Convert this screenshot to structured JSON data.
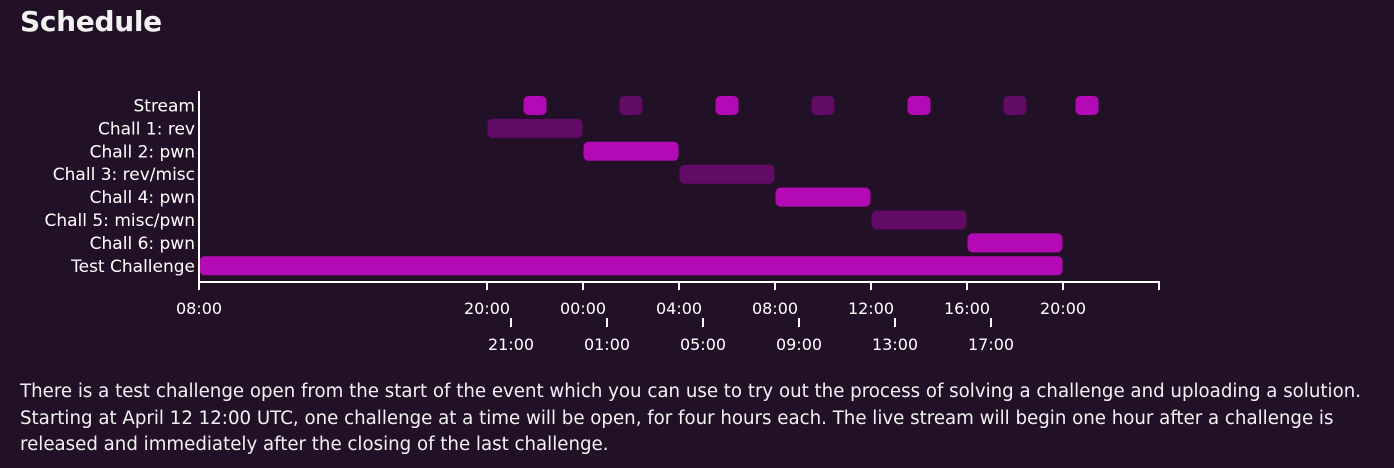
{
  "page": {
    "title": "Schedule",
    "description": "There is a test challenge open from the start of the event which you can use to try out the process of solving a challenge and uploading a solution. Starting at April 12 12:00 UTC, one challenge at a time will be open, for four hours each. The live stream will begin one hour after a challenge is released and immediately after the closing of the last challenge."
  },
  "colors": {
    "background": "#221126",
    "bright": "#b30ab5",
    "dim": "#620b66",
    "text": "#ffffff"
  },
  "chart_data": {
    "type": "gantt",
    "x_unit": "hours from axis start (08:00)",
    "xlim": [
      0,
      40
    ],
    "rows": [
      "Stream",
      "Chall 1: rev",
      "Chall 2: pwn",
      "Chall 3: rev/misc",
      "Chall 4: pwn",
      "Chall 5: misc/pwn",
      "Chall 6: pwn",
      "Test Challenge"
    ],
    "bars": [
      {
        "row": "Stream",
        "start": 13.5,
        "end": 14.5,
        "color": "bright"
      },
      {
        "row": "Stream",
        "start": 17.5,
        "end": 18.5,
        "color": "dim"
      },
      {
        "row": "Stream",
        "start": 21.5,
        "end": 22.5,
        "color": "bright"
      },
      {
        "row": "Stream",
        "start": 25.5,
        "end": 26.5,
        "color": "dim"
      },
      {
        "row": "Stream",
        "start": 29.5,
        "end": 30.5,
        "color": "bright"
      },
      {
        "row": "Stream",
        "start": 33.5,
        "end": 34.5,
        "color": "dim"
      },
      {
        "row": "Stream",
        "start": 36.5,
        "end": 37.5,
        "color": "bright"
      },
      {
        "row": "Chall 1: rev",
        "start": 12,
        "end": 16,
        "color": "dim"
      },
      {
        "row": "Chall 2: pwn",
        "start": 16,
        "end": 20,
        "color": "bright"
      },
      {
        "row": "Chall 3: rev/misc",
        "start": 20,
        "end": 24,
        "color": "dim"
      },
      {
        "row": "Chall 4: pwn",
        "start": 24,
        "end": 28,
        "color": "bright"
      },
      {
        "row": "Chall 5: misc/pwn",
        "start": 28,
        "end": 32,
        "color": "dim"
      },
      {
        "row": "Chall 6: pwn",
        "start": 32,
        "end": 36,
        "color": "bright"
      },
      {
        "row": "Test Challenge",
        "start": 0,
        "end": 36,
        "color": "bright"
      }
    ],
    "x_ticks_top": [
      {
        "value": 0,
        "label": "08:00"
      },
      {
        "value": 12,
        "label": "20:00"
      },
      {
        "value": 16,
        "label": "00:00"
      },
      {
        "value": 20,
        "label": "04:00"
      },
      {
        "value": 24,
        "label": "08:00"
      },
      {
        "value": 28,
        "label": "12:00"
      },
      {
        "value": 32,
        "label": "16:00"
      },
      {
        "value": 36,
        "label": "20:00"
      },
      {
        "value": 40,
        "label": ""
      }
    ],
    "x_ticks_bottom": [
      {
        "value": 13,
        "label": "21:00"
      },
      {
        "value": 17,
        "label": "01:00"
      },
      {
        "value": 21,
        "label": "05:00"
      },
      {
        "value": 25,
        "label": "09:00"
      },
      {
        "value": 29,
        "label": "13:00"
      },
      {
        "value": 33,
        "label": "17:00"
      }
    ]
  }
}
